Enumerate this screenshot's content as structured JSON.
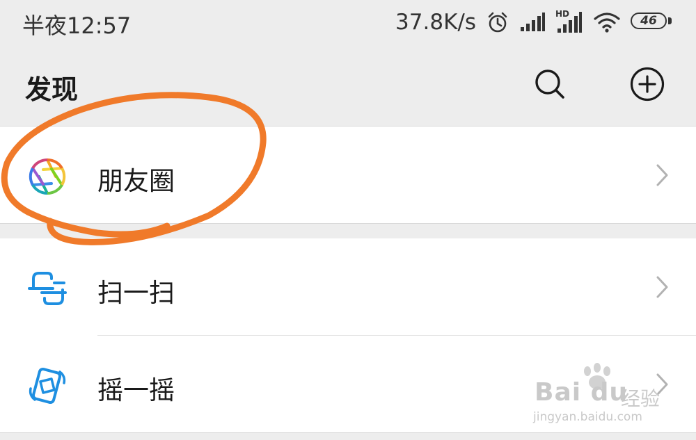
{
  "status_bar": {
    "time": "半夜12:57",
    "net_speed": "37.8K/s",
    "hd_label": "HD",
    "battery_level": "46",
    "icons": [
      "alarm-icon",
      "signal-icon",
      "hd-signal-icon",
      "wifi-icon",
      "battery-icon"
    ]
  },
  "header": {
    "title": "发现",
    "actions": [
      "search-icon",
      "plus-circle-icon"
    ]
  },
  "menu": {
    "group1": [
      {
        "label": "朋友圈",
        "icon": "moments-aperture-icon"
      }
    ],
    "group2": [
      {
        "label": "扫一扫",
        "icon": "scan-icon"
      },
      {
        "label": "摇一摇",
        "icon": "shake-icon"
      }
    ]
  },
  "annotation": {
    "color": "#f07a2a",
    "shape": "hand-drawn-circle"
  },
  "watermark": {
    "logo": "Bai du",
    "product": "经验",
    "url": "jingyan.baidu.com"
  },
  "colors": {
    "background": "#ededed",
    "card": "#ffffff",
    "accent_blue": "#1e8fe1",
    "chevron": "#b2b2b2"
  }
}
